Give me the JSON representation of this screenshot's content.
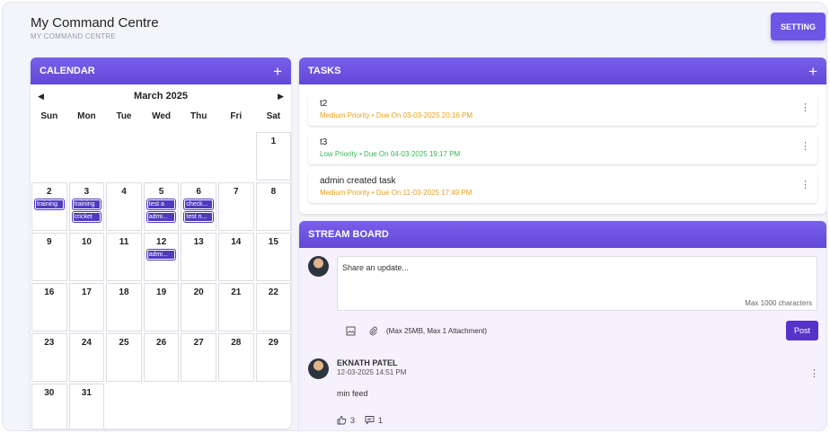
{
  "header": {
    "title": "My Command Centre",
    "subtitle": "MY COMMAND CENTRE",
    "setting_label": "SETTING"
  },
  "calendar": {
    "title": "CALENDAR",
    "add_icon": "plus-icon",
    "month_label": "March 2025",
    "prev_icon": "caret-left-icon",
    "next_icon": "caret-right-icon",
    "weekdays": [
      "Sun",
      "Mon",
      "Tue",
      "Wed",
      "Thu",
      "Fri",
      "Sat"
    ],
    "days": {
      "d1": "1",
      "d2": "2",
      "d3": "3",
      "d4": "4",
      "d5": "5",
      "d6": "6",
      "d7": "7",
      "d8": "8",
      "d9": "9",
      "d10": "10",
      "d11": "11",
      "d12": "12",
      "d13": "13",
      "d14": "14",
      "d15": "15",
      "d16": "16",
      "d17": "17",
      "d18": "18",
      "d19": "19",
      "d20": "20",
      "d21": "21",
      "d22": "22",
      "d23": "23",
      "d24": "24",
      "d25": "25",
      "d26": "26",
      "d27": "27",
      "d28": "28",
      "d29": "29",
      "d30": "30",
      "d31": "31"
    },
    "events": {
      "d2": [
        "training"
      ],
      "d3": [
        "training",
        "cricket"
      ],
      "d5": [
        "test a",
        "admi..."
      ],
      "d6": [
        "check...",
        "test n..."
      ],
      "d12": [
        "admi..."
      ]
    }
  },
  "tasks": {
    "title": "TASKS",
    "add_icon": "plus-icon",
    "items": [
      {
        "name": "t2",
        "meta": "Medium Priority • Due On 03-03-2025 20:16 PM",
        "priority": "medium"
      },
      {
        "name": "t3",
        "meta": "Low Priority • Due On 04-03-2025 19:17 PM",
        "priority": "low"
      },
      {
        "name": "admin created task",
        "meta": "Medium Priority • Due On 11-03-2025 17:49 PM",
        "priority": "medium"
      }
    ],
    "menu_glyph": "⋮"
  },
  "stream": {
    "title": "STREAM BOARD",
    "placeholder": "Share an update...",
    "max_chars": "Max 1000 characters",
    "image_icon": "image-icon",
    "attach_icon": "paperclip-icon",
    "attachment_note": "(Max 25MB, Max 1 Attachment)",
    "post_label": "Post",
    "post": {
      "author": "EKNATH PATEL",
      "time": "12-03-2025 14:51 PM",
      "text": "min feed",
      "likes": "3",
      "comments": "1",
      "menu_glyph": "⋮"
    }
  },
  "colors": {
    "accent": "#6d55e6",
    "event": "#4f3bbf",
    "medium": "#e6a21a",
    "low": "#3fb45d",
    "post_button": "#5733c9"
  }
}
